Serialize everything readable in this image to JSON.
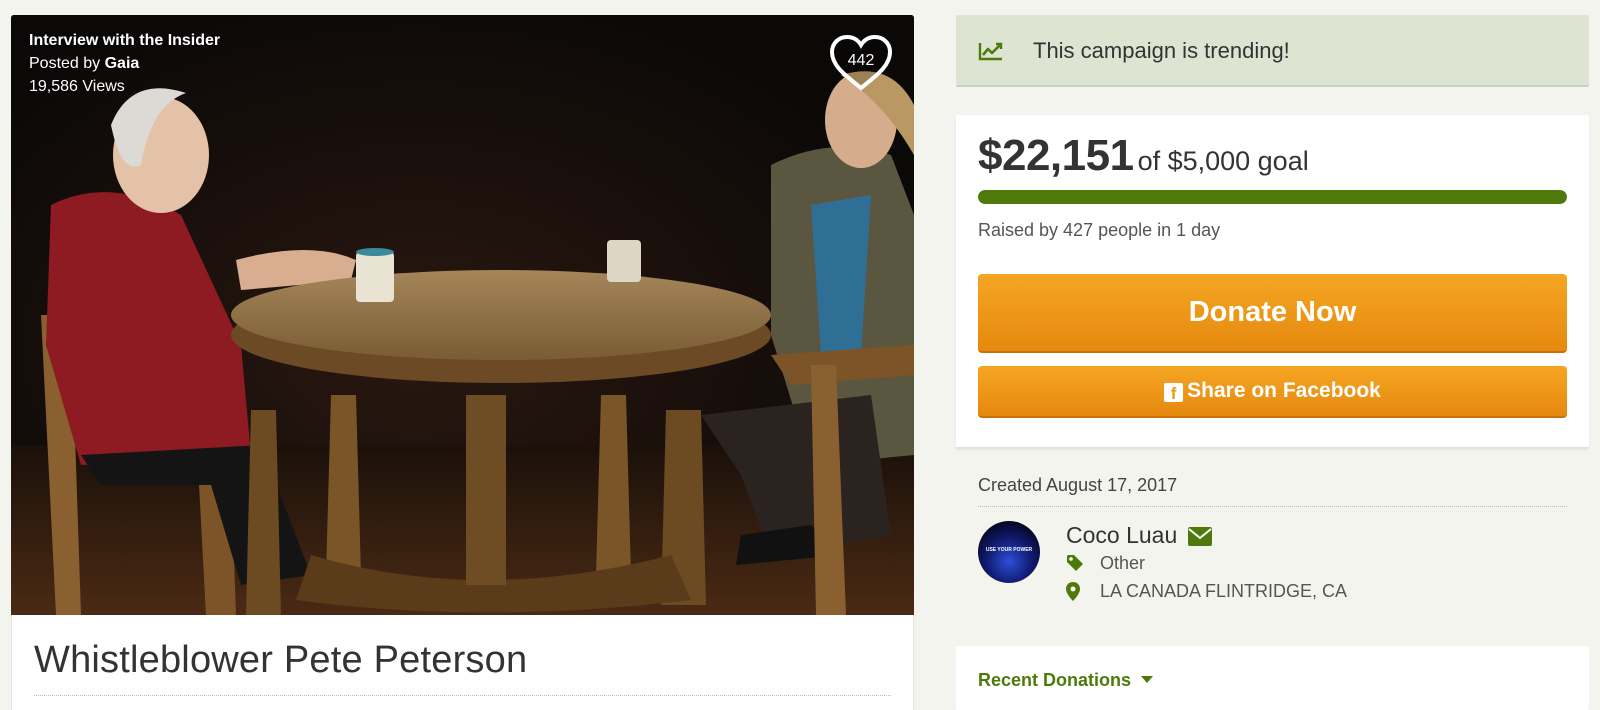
{
  "media": {
    "video_title": "Interview with the Insider",
    "posted_by_prefix": "Posted by",
    "posted_by_name": "Gaia",
    "views": "19,586 Views",
    "heart_count": "442"
  },
  "campaign": {
    "title": "Whistleblower Pete Peterson"
  },
  "trending": {
    "icon": "trending-chart-icon",
    "text": "This campaign is trending!"
  },
  "funding": {
    "raised": "$22,151",
    "goal_text": "of $5,000 goal",
    "progress_fraction": 1.0,
    "raised_by": "Raised by 427 people in 1 day"
  },
  "buttons": {
    "donate": "Donate Now",
    "share": "Share on Facebook"
  },
  "organizer": {
    "created": "Created August 17, 2017",
    "avatar_text": "USE YOUR POWER",
    "name": "Coco Luau",
    "category": "Other",
    "location": "LA CANADA FLINTRIDGE, CA"
  },
  "recent": {
    "label": "Recent Donations"
  },
  "colors": {
    "accent_green": "#4d7a0a",
    "button_orange": "#f5a623",
    "trend_bg": "#dde4d2"
  }
}
